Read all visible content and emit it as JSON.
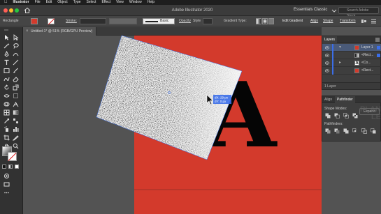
{
  "menubar": {
    "app_name": "Illustrator",
    "items": [
      "File",
      "Edit",
      "Object",
      "Type",
      "Select",
      "Effect",
      "View",
      "Window",
      "Help"
    ]
  },
  "appbar": {
    "title": "Adobe Illustrator 2020",
    "workspace": "Essentials Classic",
    "search_placeholder": "Search Adobe Stock"
  },
  "controlbar": {
    "object_type": "Rectangle",
    "stroke_label": "Stroke:",
    "brush_label": "Basic",
    "opacity_label": "Opacity",
    "style_label": "Style",
    "gradient_type_label": "Gradient Type:",
    "edit_gradient": "Edit Gradient",
    "align": "Align",
    "shape": "Shape",
    "transform": "Transform",
    "fill_color": "#d33a2c"
  },
  "document_tab": {
    "title": "Untitled-1* @ 51% (RGB/GPU Preview)"
  },
  "canvas": {
    "artboard_color": "#d33a2c",
    "letter": "A",
    "cursor_readout": [
      "dX: 29 px",
      "dY: 0 px"
    ]
  },
  "layers_panel": {
    "tabs": [
      "Layers"
    ],
    "rows": [
      {
        "name": "Layer 1",
        "thumb": "#d33a2c"
      },
      {
        "name": "<Rect...",
        "thumb": "#000000"
      },
      {
        "name": "<Co...",
        "thumb": "#000000"
      },
      {
        "name": "<Rect...",
        "thumb": "#d33a2c"
      }
    ],
    "footer": "1 Layer"
  },
  "pathfinder_panel": {
    "tabs": [
      "Align",
      "Pathfinder"
    ],
    "shape_modes_label": "Shape Modes:",
    "pathfinders_label": "Pathfinders:",
    "expand_label": "Expand",
    "watermark": "PLAN\nLE"
  }
}
